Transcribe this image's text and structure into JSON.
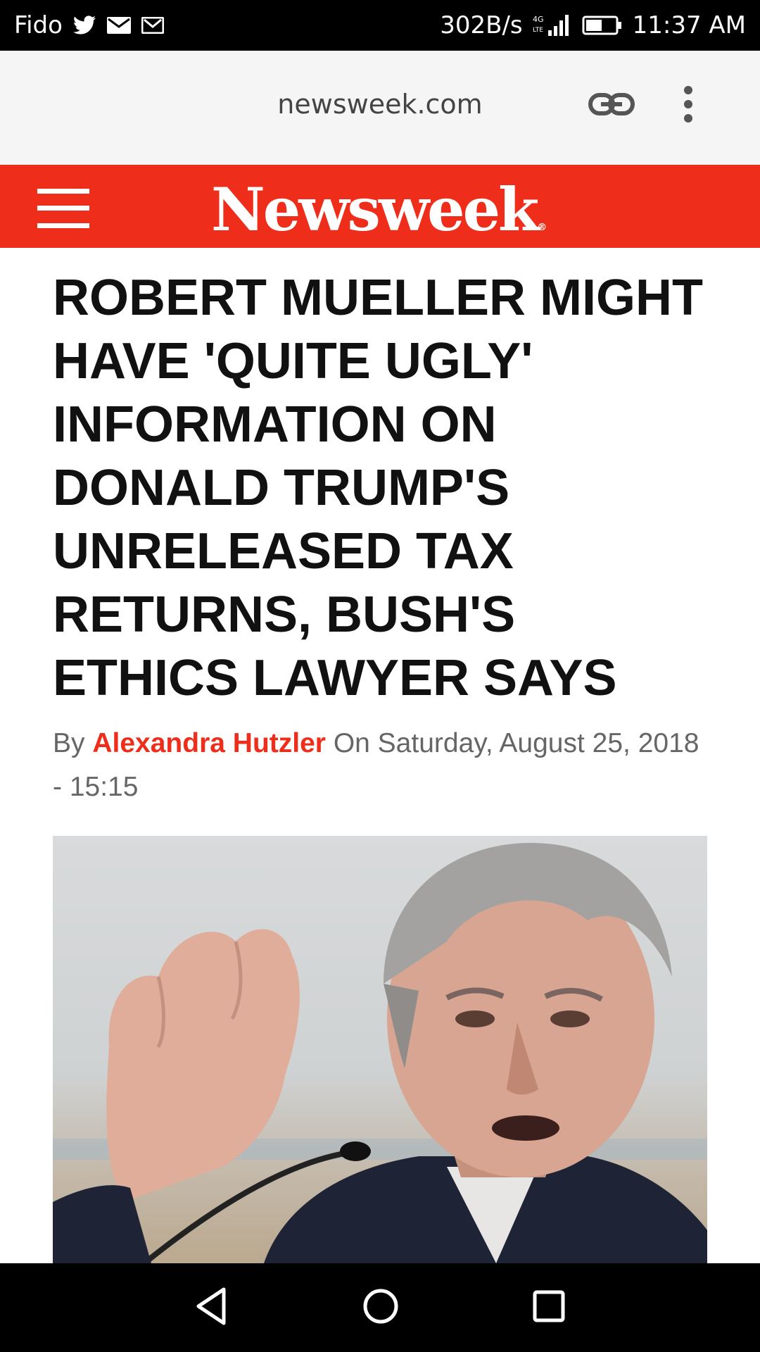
{
  "status_bar": {
    "carrier": "Fido",
    "net_speed": "302B/s",
    "network_type": "4G LTE",
    "time": "11:37 AM",
    "icons": [
      "twitter-icon",
      "mail-icon",
      "gmail-icon",
      "signal-icon",
      "battery-icon"
    ]
  },
  "browser": {
    "url": "newsweek.com",
    "icons": [
      "link-icon",
      "more-vert-icon"
    ]
  },
  "site": {
    "logo": "Newsweek",
    "logo_mark": "®",
    "brand_color": "#ee2e1b"
  },
  "article": {
    "headline": "ROBERT MUELLER MIGHT HAVE 'QUITE UGLY' INFORMATION ON DONALD TRUMP'S UNRELEASED TAX RETURNS, BUSH'S ETHICS LAWYER SAYS",
    "byline_prefix": "By",
    "author": "Alexandra Hutzler",
    "date_text": "On Saturday, August 25, 2018 - 15:15"
  },
  "nav": {
    "icons": [
      "back-icon",
      "home-icon",
      "recents-icon"
    ]
  }
}
